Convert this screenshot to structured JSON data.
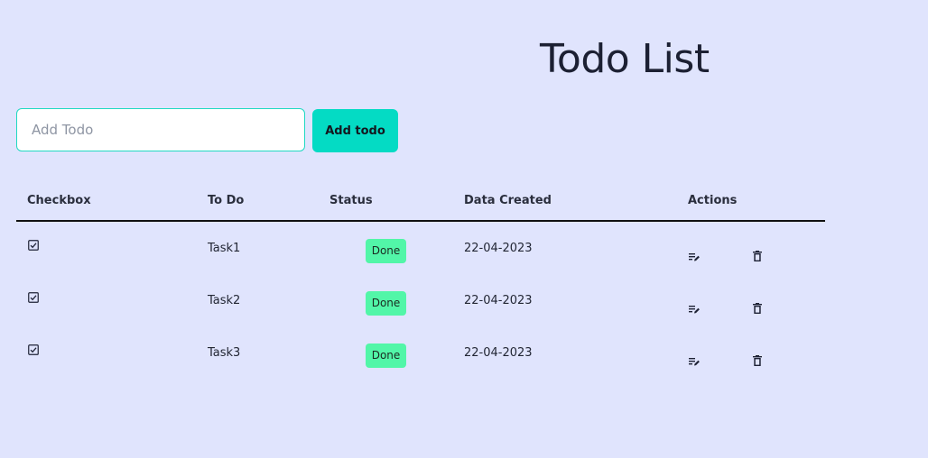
{
  "page": {
    "title": "Todo List"
  },
  "form": {
    "placeholder": "Add Todo",
    "value": "",
    "button_label": "Add todo"
  },
  "table": {
    "headers": [
      "Checkbox",
      "To Do",
      "Status",
      "Data Created",
      "Actions"
    ],
    "rows": [
      {
        "checked": true,
        "task": "Task1",
        "status": "Done",
        "date": "22-04-2023"
      },
      {
        "checked": true,
        "task": "Task2",
        "status": "Done",
        "date": "22-04-2023"
      },
      {
        "checked": true,
        "task": "Task3",
        "status": "Done",
        "date": "22-04-2023"
      }
    ]
  },
  "icons": {
    "checkbox": "checkbox-checked-icon",
    "edit": "edit-icon",
    "delete": "delete-icon"
  },
  "colors": {
    "background": "#e0e4fd",
    "accent": "#04dbc4",
    "input_border": "#20d9c2",
    "status_done": "#52f6a8",
    "text": "#1c2033"
  }
}
